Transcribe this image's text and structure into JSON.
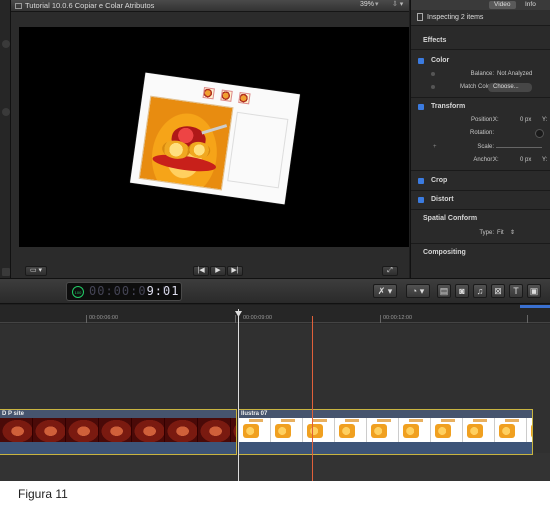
{
  "viewer": {
    "title": "Tutorial 10.0.6 Copiar e Colar Atributos",
    "zoom": "39%",
    "zoom_arrow": "▾",
    "options_icon": "⇩ ▾",
    "card_fine_print": "",
    "footer": {
      "view_menu": "▭ ▾",
      "prev": "|◀",
      "play": "▶",
      "next": "▶|",
      "fullscreen": "⤢"
    }
  },
  "inspector": {
    "tabs": [
      "Video",
      "Info"
    ],
    "header": "Inspecting 2 items",
    "sections": {
      "effects": "Effects",
      "color": "Color",
      "transform": "Transform",
      "crop": "Crop",
      "distort": "Distort",
      "spatial_conform": "Spatial Conform",
      "compositing": "Compositing"
    },
    "color": {
      "balance_label": "Balance:",
      "balance_value": "Not Analyzed",
      "match_label": "Match Color:",
      "match_button": "Choose..."
    },
    "transform": {
      "position_label": "Position:",
      "position_x_label": "X:",
      "position_x_value": "0 px",
      "position_y_label": "Y:",
      "rotation_label": "Rotation:",
      "scale_label": "Scale:",
      "anchor_label": "Anchor:",
      "anchor_x_label": "X:",
      "anchor_x_value": "0 px",
      "anchor_y_label": "Y:"
    },
    "spatial_conform": {
      "type_label": "Type:",
      "type_value": "Fit",
      "type_arrow": "⇕"
    }
  },
  "toolbar": {
    "timecode_mode": "100",
    "timecode_dim": "00:00:0",
    "timecode_bright": "9:01",
    "timecode_right": "[↑",
    "tool_select": "✗ ▾",
    "retime": "◔ ▾",
    "icons": [
      "▤",
      "◙",
      "♫",
      "⊠",
      "T",
      "▣"
    ]
  },
  "timeline": {
    "ruler_labels": [
      "00:00:06:00",
      "00:00:09:00",
      "00:00:12:00"
    ],
    "clips": [
      {
        "title": "D P site"
      },
      {
        "title": "Ilustra 07"
      }
    ]
  },
  "caption": "Figura 11",
  "colors": {
    "accent_blue": "#3b7be0",
    "playhead": "#e0603a",
    "clip_border": "#c8b440",
    "timecode_green": "#22cc66"
  }
}
